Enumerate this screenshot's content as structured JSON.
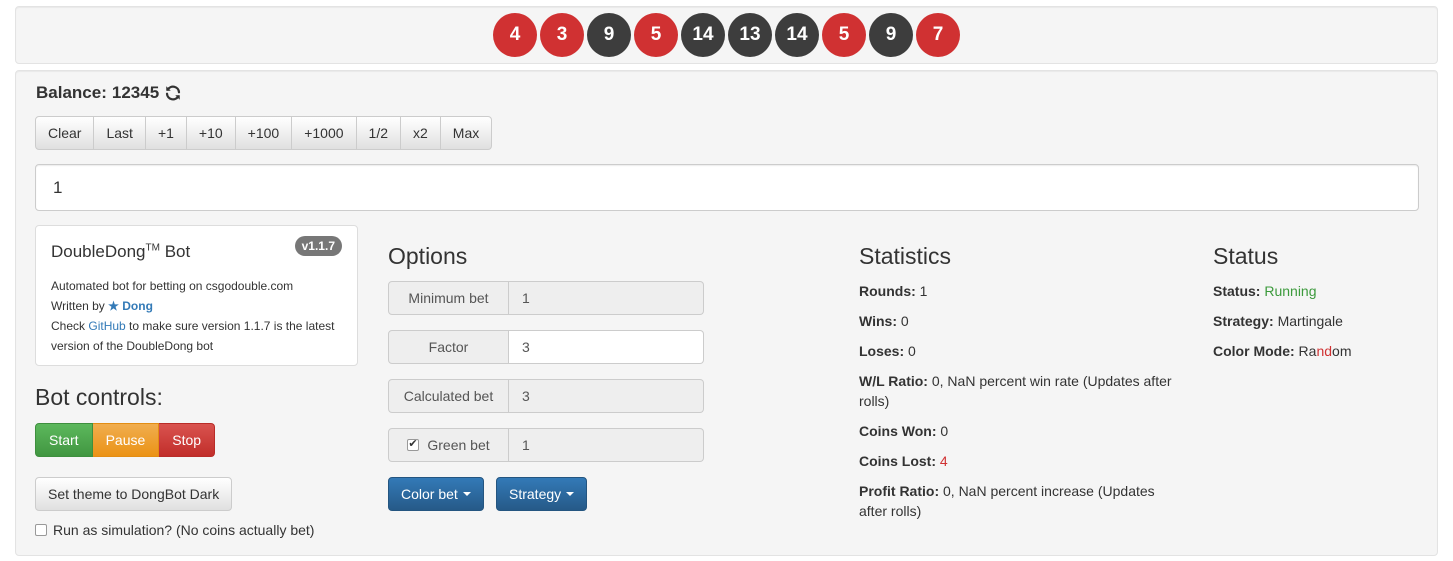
{
  "colors": {
    "red": "#d03132",
    "black": "#3d3d3d",
    "running": "#3c9a3c",
    "lost": "#d03132"
  },
  "history": [
    {
      "value": "4",
      "color": "red"
    },
    {
      "value": "3",
      "color": "red"
    },
    {
      "value": "9",
      "color": "black"
    },
    {
      "value": "5",
      "color": "red"
    },
    {
      "value": "14",
      "color": "black"
    },
    {
      "value": "13",
      "color": "black"
    },
    {
      "value": "14",
      "color": "black"
    },
    {
      "value": "5",
      "color": "red"
    },
    {
      "value": "9",
      "color": "black"
    },
    {
      "value": "7",
      "color": "red"
    }
  ],
  "balance": {
    "label": "Balance:",
    "value": "12345",
    "icon": "refresh-icon"
  },
  "bet_buttons": [
    "Clear",
    "Last",
    "+1",
    "+10",
    "+100",
    "+1000",
    "1/2",
    "x2",
    "Max"
  ],
  "bet_input": {
    "value": "1"
  },
  "info": {
    "title": "DoubleDong",
    "tm": "TM",
    "title_suffix": " Bot",
    "version": "v1.1.7",
    "line1": "Automated bot for betting on csgodouble.com",
    "written_by": "Written by ",
    "author": "Dong",
    "check_prefix": "Check ",
    "github": "GitHub",
    "check_suffix": " to make sure version 1.1.7 is the latest",
    "line4": "version of the DoubleDong bot"
  },
  "bot_controls": {
    "heading": "Bot controls:",
    "start": "Start",
    "pause": "Pause",
    "stop": "Stop",
    "theme": "Set theme to DongBot Dark",
    "simulation": "Run as simulation? (No coins actually bet)"
  },
  "options": {
    "heading": "Options",
    "rows": [
      {
        "label": "Minimum bet",
        "value": "1"
      },
      {
        "label": "Factor",
        "value": "3"
      },
      {
        "label": "Calculated bet",
        "value": "3"
      },
      {
        "label": "Green bet",
        "value": "1"
      }
    ],
    "color_bet": "Color bet",
    "strategy": "Strategy"
  },
  "statistics": {
    "heading": "Statistics",
    "rounds_label": "Rounds:",
    "rounds": "1",
    "wins_label": "Wins:",
    "wins": "0",
    "loses_label": "Loses:",
    "loses": "0",
    "wl_label": "W/L Ratio:",
    "wl_line1": "0, NaN percent win rate (Updates after",
    "wl_line2": "rolls)",
    "coins_won_label": "Coins Won:",
    "coins_won": "0",
    "coins_lost_label": "Coins Lost:",
    "coins_lost": "4",
    "profit_label": "Profit Ratio:",
    "profit_line1": "0, NaN percent increase (Updates",
    "profit_line2": "after rolls)"
  },
  "status": {
    "heading": "Status",
    "status_label": "Status:",
    "status_value": "Running",
    "strategy_label": "Strategy:",
    "strategy_value": "Martingale",
    "color_mode_label": "Color Mode:",
    "color_mode_a": "Ra",
    "color_mode_b": "nd",
    "color_mode_c": "om"
  }
}
